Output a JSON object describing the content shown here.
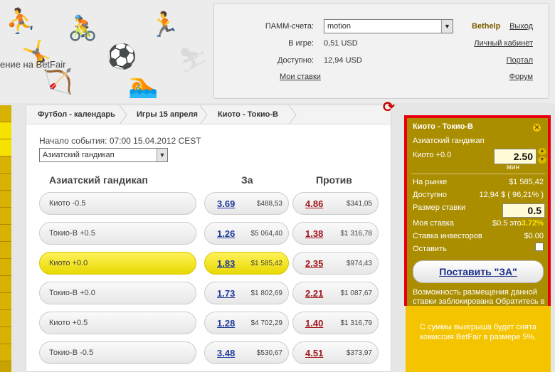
{
  "header": {
    "brand_text": "ение на BetFair",
    "account": {
      "pamm_label": "ПАММ-счета:",
      "pamm_selected": "motion",
      "in_play_label": "В игре:",
      "in_play_value": "0,51 USD",
      "available_label": "Доступно:",
      "available_value": "12,94 USD",
      "my_bets_link": "Мои ставки",
      "bethelp": "Bethelp",
      "logout_link": "Выход",
      "cabinet_link": "Личный кабинет",
      "portal_link": "Портал",
      "forum_link": "Форум"
    }
  },
  "breadcrumbs": [
    "Футбол - календарь",
    "Игры 15 апреля",
    "Киото - Токио-В"
  ],
  "event": {
    "start_text": "Начало события: 07:00 15.04.2012 CEST",
    "market_selected": "Азиатский гандикап"
  },
  "table": {
    "col_selection": "Азиатский гандикап",
    "col_back": "За",
    "col_lay": "Против",
    "rows": [
      {
        "name": "Киото -0.5",
        "back_odds": "3.69",
        "back_amount": "$488,53",
        "lay_odds": "4.86",
        "lay_amount": "$341,05"
      },
      {
        "name": "Токио-В +0.5",
        "back_odds": "1.26",
        "back_amount": "$5 064,40",
        "lay_odds": "1.38",
        "lay_amount": "$1 316,78"
      },
      {
        "name": "Киото +0.0",
        "back_odds": "1.83",
        "back_amount": "$1 585,42",
        "lay_odds": "2.35",
        "lay_amount": "$974,43"
      },
      {
        "name": "Токио-В +0.0",
        "back_odds": "1.73",
        "back_amount": "$1 802,69",
        "lay_odds": "2.21",
        "lay_amount": "$1 087,67"
      },
      {
        "name": "Киото +0.5",
        "back_odds": "1.28",
        "back_amount": "$4 702,29",
        "lay_odds": "1.40",
        "lay_amount": "$1 316,79"
      },
      {
        "name": "Токио-В -0.5",
        "back_odds": "3.48",
        "back_amount": "$530,67",
        "lay_odds": "4.51",
        "lay_amount": "$373,97"
      }
    ]
  },
  "betslip": {
    "title": "Киото - Токио-В",
    "market": "Азиатский гандикап",
    "selection": "Киото +0.0",
    "odds": "2.50",
    "min_label": "мин",
    "on_market_label": "На рынке",
    "on_market_value": "$1 585,42",
    "available_label": "Доступно",
    "available_value": "12,94 $ ( 96,21% )",
    "stake_label": "Размер ставки",
    "stake_value": "0.5",
    "my_stake_label": "Моя ставка",
    "my_stake_value": "$0.5 это",
    "my_stake_pct": "3.72%",
    "investor_label": "Ставка инвесторов",
    "investor_value": "$0.00",
    "keep_label": "Оставить",
    "place_button": "Поставить \"ЗА\"",
    "warning": "Возможность размещения данной ставки заблокирована Обратитесь в службу поддержки",
    "note": "С суммы выигрыша будет снята комиссия BetFair в размере 5%."
  }
}
